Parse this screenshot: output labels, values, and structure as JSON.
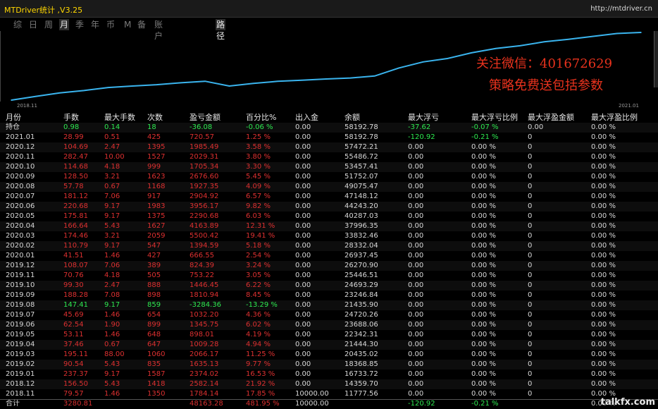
{
  "app_title": "MTDriver统计 ,V3.25",
  "site_url": "http://mtdriver.cn",
  "tabs": [
    "综",
    "日",
    "周",
    "月",
    "季",
    "年",
    "币",
    "M",
    "备",
    "账户",
    "路径"
  ],
  "active_tab": "月",
  "chart_data": {
    "type": "line",
    "x_start_label": "2018.11",
    "x_end_label": "2021.01",
    "x": [
      "2018.11",
      "2018.12",
      "2019.01",
      "2019.02",
      "2019.03",
      "2019.04",
      "2019.05",
      "2019.06",
      "2019.07",
      "2019.08",
      "2019.09",
      "2019.10",
      "2019.11",
      "2019.12",
      "2020.01",
      "2020.02",
      "2020.03",
      "2020.04",
      "2020.05",
      "2020.06",
      "2020.07",
      "2020.08",
      "2020.09",
      "2020.10",
      "2020.11",
      "2020.12",
      "2021.01"
    ],
    "values": [
      11777.56,
      14359.7,
      16733.72,
      18368.85,
      20435.02,
      21444.3,
      22342.31,
      23688.06,
      24720.26,
      21435.9,
      23246.84,
      24693.29,
      25446.51,
      26270.9,
      26937.45,
      28332.04,
      33832.46,
      37996.35,
      40287.03,
      44243.2,
      47148.12,
      49075.47,
      51752.07,
      53457.41,
      55486.72,
      57472.21,
      58192.78
    ],
    "series_color": "#3ab4ee"
  },
  "promo": {
    "line1": "关注微信：401672629",
    "line2": "策略免费送包括参数"
  },
  "table": {
    "columns": [
      "月份",
      "手数",
      "最大手数",
      "次数",
      "盈亏金额",
      "百分比%",
      "出入金",
      "余额",
      "最大浮亏",
      "最大浮亏比例",
      "最大浮盈金额",
      "最大浮盈比例"
    ],
    "holding": [
      "持仓",
      "0.98",
      "0.14",
      "18",
      "-36.08",
      "-0.06 %",
      "0.00",
      "58192.78",
      "-37.62",
      "-0.07 %",
      "0.00",
      "0.00 %"
    ],
    "rows": [
      [
        "2021.01",
        "28.99",
        "0.51",
        "425",
        "720.57",
        "1.25 %",
        "0.00",
        "58192.78",
        "-120.92",
        "-0.21 %",
        "0",
        "0.00 %"
      ],
      [
        "2020.12",
        "104.69",
        "2.47",
        "1395",
        "1985.49",
        "3.58 %",
        "0.00",
        "57472.21",
        "0.00",
        "0.00 %",
        "0",
        "0.00 %"
      ],
      [
        "2020.11",
        "282.47",
        "10.00",
        "1527",
        "2029.31",
        "3.80 %",
        "0.00",
        "55486.72",
        "0.00",
        "0.00 %",
        "0",
        "0.00 %"
      ],
      [
        "2020.10",
        "114.68",
        "4.18",
        "999",
        "1705.34",
        "3.30 %",
        "0.00",
        "53457.41",
        "0.00",
        "0.00 %",
        "0",
        "0.00 %"
      ],
      [
        "2020.09",
        "128.50",
        "3.21",
        "1623",
        "2676.60",
        "5.45 %",
        "0.00",
        "51752.07",
        "0.00",
        "0.00 %",
        "0",
        "0.00 %"
      ],
      [
        "2020.08",
        "57.78",
        "0.67",
        "1168",
        "1927.35",
        "4.09 %",
        "0.00",
        "49075.47",
        "0.00",
        "0.00 %",
        "0",
        "0.00 %"
      ],
      [
        "2020.07",
        "181.12",
        "7.06",
        "917",
        "2904.92",
        "6.57 %",
        "0.00",
        "47148.12",
        "0.00",
        "0.00 %",
        "0",
        "0.00 %"
      ],
      [
        "2020.06",
        "220.68",
        "9.17",
        "1983",
        "3956.17",
        "9.82 %",
        "0.00",
        "44243.20",
        "0.00",
        "0.00 %",
        "0",
        "0.00 %"
      ],
      [
        "2020.05",
        "175.81",
        "9.17",
        "1375",
        "2290.68",
        "6.03 %",
        "0.00",
        "40287.03",
        "0.00",
        "0.00 %",
        "0",
        "0.00 %"
      ],
      [
        "2020.04",
        "166.64",
        "5.43",
        "1627",
        "4163.89",
        "12.31 %",
        "0.00",
        "37996.35",
        "0.00",
        "0.00 %",
        "0",
        "0.00 %"
      ],
      [
        "2020.03",
        "174.46",
        "3.21",
        "2059",
        "5500.42",
        "19.41 %",
        "0.00",
        "33832.46",
        "0.00",
        "0.00 %",
        "0",
        "0.00 %"
      ],
      [
        "2020.02",
        "110.79",
        "9.17",
        "547",
        "1394.59",
        "5.18 %",
        "0.00",
        "28332.04",
        "0.00",
        "0.00 %",
        "0",
        "0.00 %"
      ],
      [
        "2020.01",
        "41.51",
        "1.46",
        "427",
        "666.55",
        "2.54 %",
        "0.00",
        "26937.45",
        "0.00",
        "0.00 %",
        "0",
        "0.00 %"
      ],
      [
        "2019.12",
        "108.07",
        "7.06",
        "389",
        "824.39",
        "3.24 %",
        "0.00",
        "26270.90",
        "0.00",
        "0.00 %",
        "0",
        "0.00 %"
      ],
      [
        "2019.11",
        "70.76",
        "4.18",
        "505",
        "753.22",
        "3.05 %",
        "0.00",
        "25446.51",
        "0.00",
        "0.00 %",
        "0",
        "0.00 %"
      ],
      [
        "2019.10",
        "99.30",
        "2.47",
        "888",
        "1446.45",
        "6.22 %",
        "0.00",
        "24693.29",
        "0.00",
        "0.00 %",
        "0",
        "0.00 %"
      ],
      [
        "2019.09",
        "188.28",
        "7.08",
        "898",
        "1810.94",
        "8.45 %",
        "0.00",
        "23246.84",
        "0.00",
        "0.00 %",
        "0",
        "0.00 %"
      ],
      [
        "2019.08",
        "147.41",
        "9.17",
        "859",
        "-3284.36",
        "-13.29 %",
        "0.00",
        "21435.90",
        "0.00",
        "0.00 %",
        "0",
        "0.00 %"
      ],
      [
        "2019.07",
        "45.69",
        "1.46",
        "654",
        "1032.20",
        "4.36 %",
        "0.00",
        "24720.26",
        "0.00",
        "0.00 %",
        "0",
        "0.00 %"
      ],
      [
        "2019.06",
        "62.54",
        "1.90",
        "899",
        "1345.75",
        "6.02 %",
        "0.00",
        "23688.06",
        "0.00",
        "0.00 %",
        "0",
        "0.00 %"
      ],
      [
        "2019.05",
        "53.11",
        "1.46",
        "648",
        "898.01",
        "4.19 %",
        "0.00",
        "22342.31",
        "0.00",
        "0.00 %",
        "0",
        "0.00 %"
      ],
      [
        "2019.04",
        "37.46",
        "0.67",
        "647",
        "1009.28",
        "4.94 %",
        "0.00",
        "21444.30",
        "0.00",
        "0.00 %",
        "0",
        "0.00 %"
      ],
      [
        "2019.03",
        "195.11",
        "88.00",
        "1060",
        "2066.17",
        "11.25 %",
        "0.00",
        "20435.02",
        "0.00",
        "0.00 %",
        "0",
        "0.00 %"
      ],
      [
        "2019.02",
        "90.54",
        "5.43",
        "835",
        "1635.13",
        "9.77 %",
        "0.00",
        "18368.85",
        "0.00",
        "0.00 %",
        "0",
        "0.00 %"
      ],
      [
        "2019.01",
        "237.37",
        "9.17",
        "1587",
        "2374.02",
        "16.53 %",
        "0.00",
        "16733.72",
        "0.00",
        "0.00 %",
        "0",
        "0.00 %"
      ],
      [
        "2018.12",
        "156.50",
        "5.43",
        "1418",
        "2582.14",
        "21.92 %",
        "0.00",
        "14359.70",
        "0.00",
        "0.00 %",
        "0",
        "0.00 %"
      ],
      [
        "2018.11",
        "79.57",
        "1.46",
        "1350",
        "1784.14",
        "17.85 %",
        "10000.00",
        "11777.56",
        "0.00",
        "0.00 %",
        "0",
        "0.00 %"
      ]
    ],
    "total": [
      "合计",
      "3280.81",
      "",
      "",
      "48163.28",
      "481.95 %",
      "10000.00",
      "",
      "-120.92",
      "-0.21 %",
      "",
      "0.00 %"
    ]
  },
  "watermark": "talkfx.com",
  "colors": {
    "profit": "#dd3030",
    "loss": "#2ee850",
    "neutral": "#d8d8d8",
    "title": "#ffd700"
  }
}
